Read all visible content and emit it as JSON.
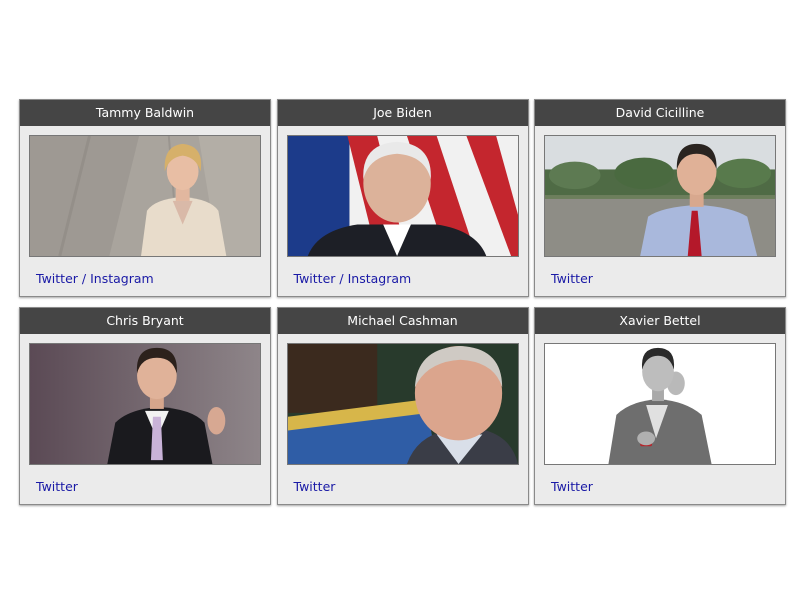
{
  "cards": [
    {
      "name": "Tammy Baldwin",
      "links": [
        "Twitter",
        "Instagram"
      ],
      "separator": "/"
    },
    {
      "name": "Joe Biden",
      "links": [
        "Twitter",
        "Instagram"
      ],
      "separator": "/"
    },
    {
      "name": "David Cicilline",
      "links": [
        "Twitter"
      ]
    },
    {
      "name": "Chris Bryant",
      "links": [
        "Twitter"
      ]
    },
    {
      "name": "Michael Cashman",
      "links": [
        "Twitter"
      ]
    },
    {
      "name": "Xavier Bettel",
      "links": [
        "Twitter"
      ]
    }
  ],
  "colors": {
    "header_bg": "#454545",
    "card_bg": "#ebebeb",
    "link": "#1a1aa6"
  }
}
